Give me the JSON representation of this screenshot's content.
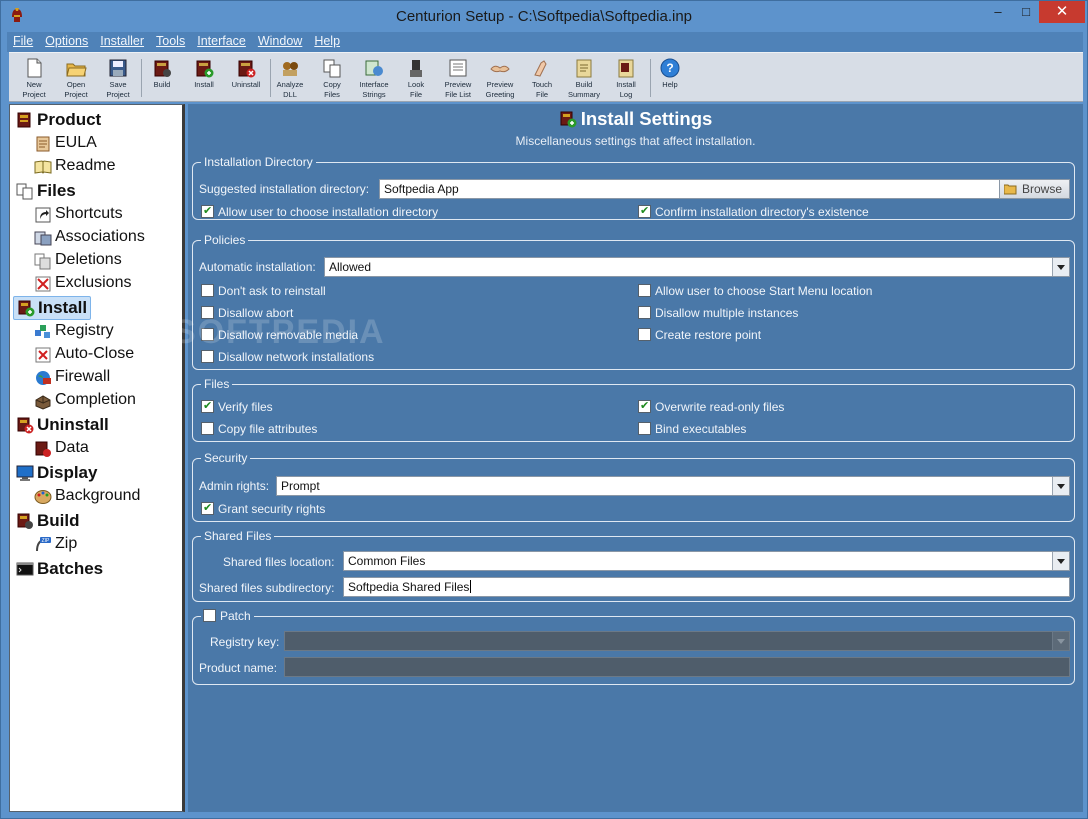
{
  "window": {
    "title": "Centurion Setup - C:\\Softpedia\\Softpedia.inp",
    "minimize": "–",
    "maximize": "□",
    "close": "✕"
  },
  "menu": [
    "File",
    "Options",
    "Installer",
    "Tools",
    "Interface",
    "Window",
    "Help"
  ],
  "toolbar": [
    {
      "line1": "New",
      "line2": "Project",
      "icon": "new-project-icon"
    },
    {
      "line1": "Open",
      "line2": "Project",
      "icon": "open-project-icon"
    },
    {
      "line1": "Save",
      "line2": "Project",
      "icon": "save-project-icon"
    },
    {
      "line1": "Build",
      "line2": "",
      "icon": "build-icon"
    },
    {
      "line1": "Install",
      "line2": "",
      "icon": "install-icon"
    },
    {
      "line1": "Uninstall",
      "line2": "",
      "icon": "uninstall-icon"
    },
    {
      "line1": "Analyze",
      "line2": "DLL",
      "icon": "analyze-dll-icon"
    },
    {
      "line1": "Copy",
      "line2": "Files",
      "icon": "copy-files-icon"
    },
    {
      "line1": "Interface",
      "line2": "Strings",
      "icon": "interface-strings-icon"
    },
    {
      "line1": "Look",
      "line2": "File",
      "icon": "look-file-icon"
    },
    {
      "line1": "Preview",
      "line2": "File List",
      "icon": "preview-file-list-icon"
    },
    {
      "line1": "Preview",
      "line2": "Greeting",
      "icon": "preview-greeting-icon"
    },
    {
      "line1": "Touch",
      "line2": "File",
      "icon": "touch-file-icon"
    },
    {
      "line1": "Build",
      "line2": "Summary",
      "icon": "build-summary-icon"
    },
    {
      "line1": "Install",
      "line2": "Log",
      "icon": "install-log-icon"
    },
    {
      "line1": "Help",
      "line2": "",
      "icon": "help-icon"
    }
  ],
  "tree": {
    "product": "Product",
    "eula": "EULA",
    "readme": "Readme",
    "files": "Files",
    "shortcuts": "Shortcuts",
    "associations": "Associations",
    "deletions": "Deletions",
    "exclusions": "Exclusions",
    "install": "Install",
    "registry": "Registry",
    "autoclose": "Auto-Close",
    "firewall": "Firewall",
    "completion": "Completion",
    "uninstall": "Uninstall",
    "data": "Data",
    "display": "Display",
    "background": "Background",
    "build": "Build",
    "zip": "Zip",
    "batches": "Batches"
  },
  "header": {
    "title": "Install Settings",
    "subtitle": "Miscellaneous settings that affect installation."
  },
  "installdir": {
    "title": "Installation Directory",
    "suggested_label": "Suggested installation directory:",
    "suggested_value": "Softpedia App",
    "browse": "Browse",
    "allow_choose": "Allow user to choose installation directory",
    "confirm_exist": "Confirm installation directory's existence"
  },
  "policies": {
    "title": "Policies",
    "auto_label": "Automatic installation:",
    "auto_value": "Allowed",
    "dont_ask": "Don't ask to reinstall",
    "disallow_abort": "Disallow abort",
    "disallow_removable": "Disallow removable media",
    "disallow_network": "Disallow network installations",
    "allow_startmenu": "Allow user to choose Start Menu location",
    "disallow_multiple": "Disallow multiple instances",
    "restore_point": "Create restore point"
  },
  "files": {
    "title": "Files",
    "verify": "Verify files",
    "copy_attr": "Copy file attributes",
    "overwrite_ro": "Overwrite read-only files",
    "bind_exe": "Bind executables"
  },
  "security": {
    "title": "Security",
    "admin_label": "Admin rights:",
    "admin_value": "Prompt",
    "grant": "Grant security rights"
  },
  "shared": {
    "title": "Shared Files",
    "location_label": "Shared files location:",
    "location_value": "Common Files",
    "subdir_label": "Shared files subdirectory:",
    "subdir_value": "Softpedia Shared Files"
  },
  "patch": {
    "title": "Patch",
    "registry_label": "Registry key:",
    "product_label": "Product name:"
  },
  "watermark": "SOFTPEDIA",
  "colors": {
    "panel_bg": "#4a78a8",
    "chrome_bg": "#5d93cc",
    "close_red": "#c73a2f",
    "check_green": "#1e8a1e"
  }
}
